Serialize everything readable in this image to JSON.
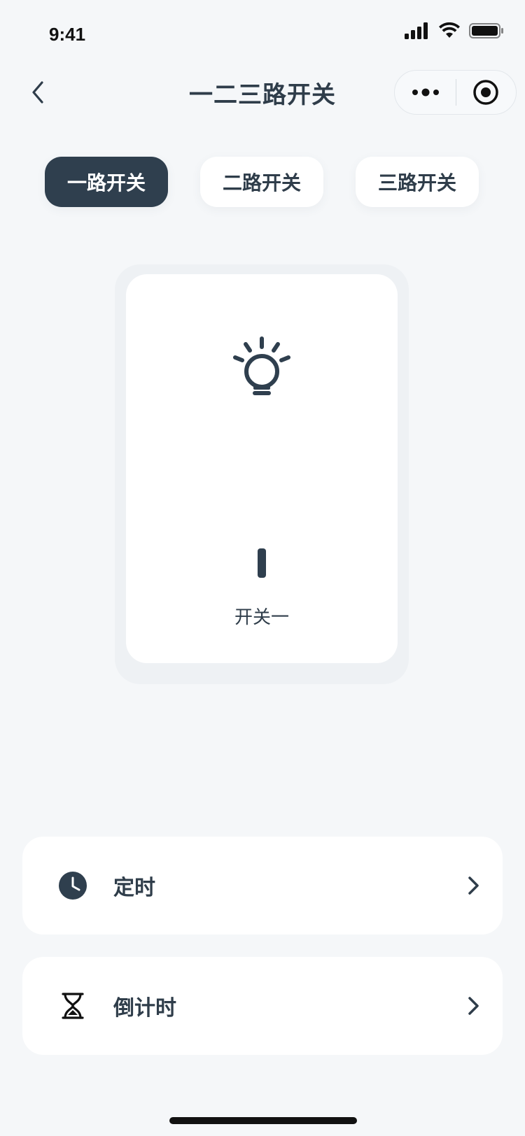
{
  "status_bar": {
    "time": "9:41"
  },
  "nav": {
    "title": "一二三路开关"
  },
  "tabs": [
    {
      "label": "一路开关",
      "active": true
    },
    {
      "label": "二路开关",
      "active": false
    },
    {
      "label": "三路开关",
      "active": false
    }
  ],
  "switch_panel": {
    "name": "开关一",
    "icon": "lightbulb-icon"
  },
  "menu": [
    {
      "label": "定时",
      "icon": "clock-icon"
    },
    {
      "label": "倒计时",
      "icon": "hourglass-icon"
    }
  ],
  "colors": {
    "background": "#f5f7f9",
    "accent": "#2f3f4e",
    "card": "#ffffff",
    "text": "#2f3d4a"
  }
}
